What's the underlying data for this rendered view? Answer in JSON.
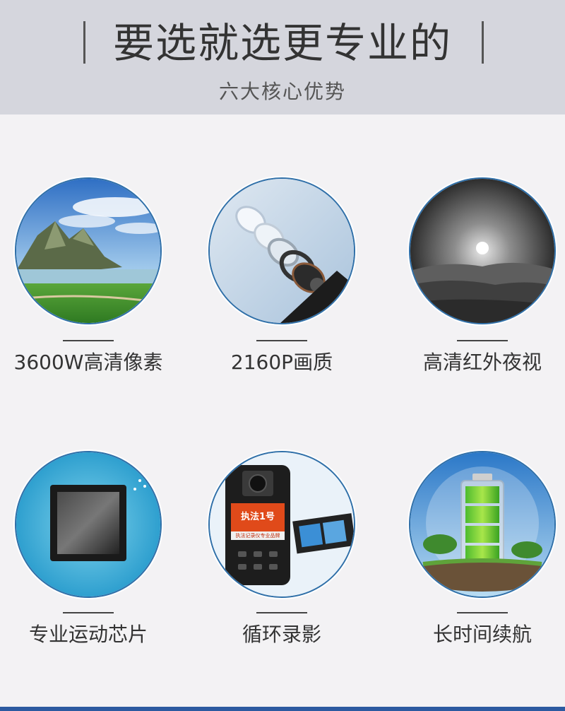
{
  "header": {
    "title": "要选就选更专业的",
    "subtitle": "六大核心优势"
  },
  "features": [
    {
      "label": "3600W高清像素",
      "icon": "landscape-icon"
    },
    {
      "label": "2160P画质",
      "icon": "lens-icon"
    },
    {
      "label": "高清红外夜视",
      "icon": "night-vision-icon"
    },
    {
      "label": "专业运动芯片",
      "icon": "chip-icon"
    },
    {
      "label": "循环录影",
      "icon": "camera-device-icon"
    },
    {
      "label": "长时间续航",
      "icon": "battery-icon"
    }
  ],
  "device_badge": {
    "brand": "执法1号",
    "tagline": "执法记录仪专业品牌"
  },
  "colors": {
    "header_bg": "#d5d6dd",
    "ring": "#2f6fa8",
    "accent": "#2c5aa0"
  }
}
